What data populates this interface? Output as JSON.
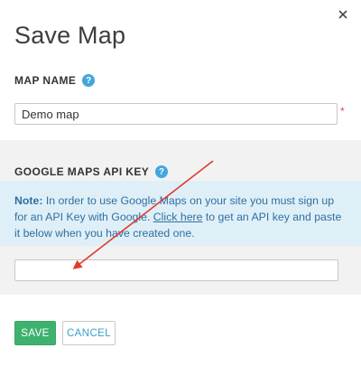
{
  "dialog": {
    "title": "Save Map"
  },
  "map_name": {
    "label": "MAP NAME",
    "help": "?",
    "value": "Demo map",
    "required_marker": "*"
  },
  "api_key": {
    "label": "GOOGLE MAPS API KEY",
    "help": "?",
    "note_prefix": "Note:",
    "note_text_1": " In order to use Google Maps on your site you must sign up for an API Key with Google. ",
    "note_link": "Click here",
    "note_text_2": " to get an API key and paste it below when you have created one.",
    "value": ""
  },
  "buttons": {
    "save": "SAVE",
    "cancel": "CANCEL"
  },
  "colors": {
    "annotation_arrow": "#e03a2c",
    "save_button": "#3fb16f",
    "help_icon": "#43a6dd",
    "note_background": "#dfeff8"
  }
}
